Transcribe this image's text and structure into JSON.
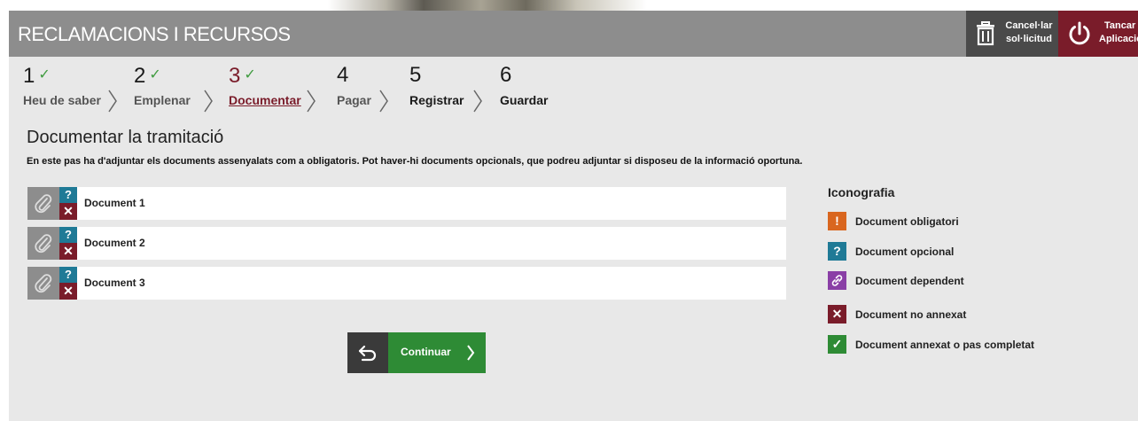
{
  "app": {
    "title": "RECLAMACIONS I RECURSOS",
    "cancel_label_1": "Cancel·lar",
    "cancel_label_2": "sol·licitud",
    "close_label_1": "Tancar",
    "close_label_2": "Aplicació"
  },
  "steps": [
    {
      "num": "1",
      "check": "✓",
      "label": "Heu de saber"
    },
    {
      "num": "2",
      "check": "✓",
      "label": "Emplenar"
    },
    {
      "num": "3",
      "check": "✓",
      "label": "Documentar"
    },
    {
      "num": "4",
      "check": "",
      "label": "Pagar"
    },
    {
      "num": "5",
      "check": "",
      "label": "Registrar"
    },
    {
      "num": "6",
      "check": "",
      "label": "Guardar"
    }
  ],
  "main": {
    "page_title": "Documentar la tramitació",
    "intro": "En este pas ha d'adjuntar els documents assenyalats com a obligatoris. Pot haver-hi documents opcionals, que podreu adjuntar si disposeu de la informació oportuna.",
    "documents": [
      {
        "name": "Document 1",
        "type_glyph": "?",
        "status_glyph": "✕"
      },
      {
        "name": "Document 2",
        "type_glyph": "?",
        "status_glyph": "✕"
      },
      {
        "name": "Document 3",
        "type_glyph": "?",
        "status_glyph": "✕"
      }
    ],
    "continue_label": "Continuar"
  },
  "legend": {
    "title": "Iconografia",
    "items": [
      {
        "glyph": "!",
        "label": "Document obligatori",
        "color": "#d9661f"
      },
      {
        "glyph": "?",
        "label": "Document opcional",
        "color": "#1f7a96"
      },
      {
        "glyph": "🔗",
        "label": "Document dependent",
        "color": "#8a3fa6"
      },
      {
        "glyph": "✕",
        "label": "Document no annexat",
        "color": "#7a1c2a"
      },
      {
        "glyph": "✓",
        "label": "Document annexat o pas completat",
        "color": "#2e8b35"
      }
    ]
  },
  "colors": {
    "accent": "#7a1c2a",
    "success": "#2e8b35",
    "header": "#8d8d8d"
  }
}
